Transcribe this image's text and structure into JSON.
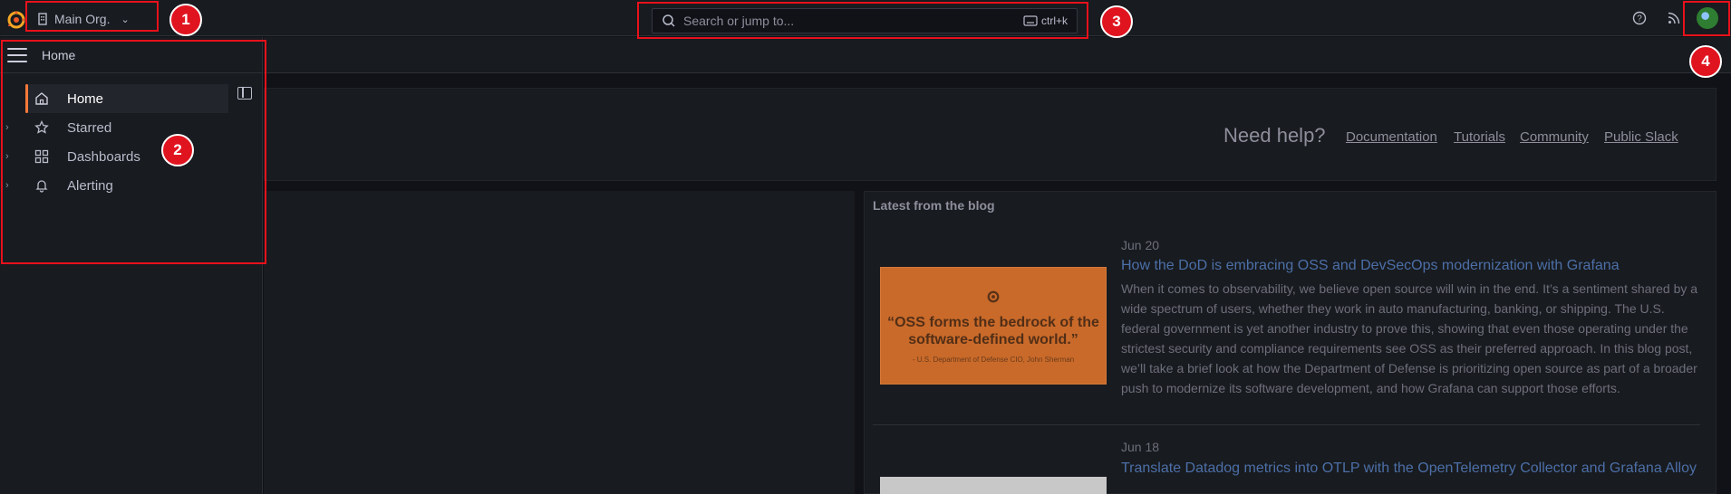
{
  "topbar": {
    "org_label": "Main Org.",
    "search_placeholder": "Search or jump to...",
    "search_shortcut": "ctrl+k"
  },
  "nav": {
    "breadcrumb": "Home",
    "items": [
      {
        "label": "Home",
        "icon": "home-icon",
        "active": true
      },
      {
        "label": "Starred",
        "icon": "star-icon"
      },
      {
        "label": "Dashboards",
        "icon": "apps-icon"
      },
      {
        "label": "Alerting",
        "icon": "bell-icon"
      }
    ]
  },
  "help": {
    "title": "Need help?",
    "links": [
      "Documentation",
      "Tutorials",
      "Community",
      "Public Slack"
    ]
  },
  "blog": {
    "title": "Latest from the blog",
    "posts": [
      {
        "date": "Jun 20",
        "title": "How the DoD is embracing OSS and DevSecOps modernization with Grafana",
        "body": "When it comes to observability, we believe open source will win in the end. It’s a sentiment shared by a wide spectrum of users, whether they work in auto manufacturing, banking, or shipping. The U.S. federal government is yet another industry to prove this, showing that even those operating under the strictest security and compliance requirements see OSS as their preferred approach. In this blog post, we’ll take a brief look at how the Department of Defense is prioritizing open source as part of a broader push to modernize its software development, and how Grafana can support those efforts.",
        "image_quote": "“OSS forms the bedrock of the software-defined world.”",
        "image_attribution": "- U.S. Department of Defense CIO, John Sherman"
      },
      {
        "date": "Jun 18",
        "title": "Translate Datadog metrics into OTLP with the OpenTelemetry Collector and Grafana Alloy"
      }
    ]
  },
  "callouts": [
    "1",
    "2",
    "3",
    "4"
  ],
  "colors": {
    "accent": "#f5793b",
    "callout": "#e8111b",
    "link": "#4c6fa8"
  }
}
